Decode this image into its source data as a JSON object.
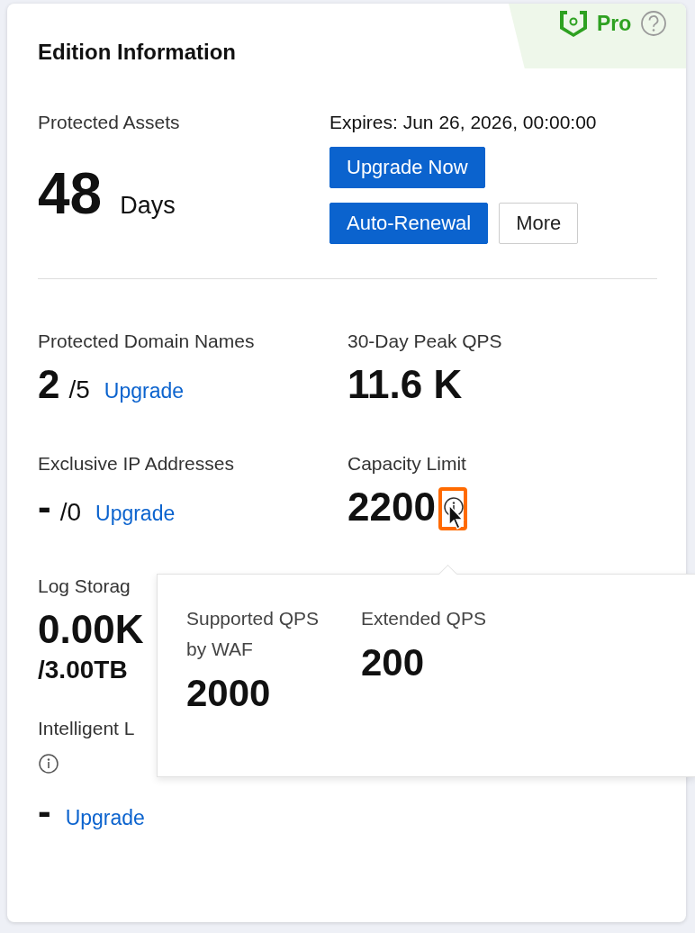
{
  "card": {
    "title": "Edition Information",
    "edition": "Pro"
  },
  "assets": {
    "label": "Protected Assets",
    "value": "48",
    "unit": "Days"
  },
  "expires": "Expires: Jun 26, 2026, 00:00:00",
  "buttons": [
    {
      "label": "Upgrade Now",
      "kind": "primary"
    },
    {
      "label": "Auto-Renewal",
      "kind": "primary"
    },
    {
      "label": "More",
      "kind": "secondary"
    }
  ],
  "left_metrics": [
    {
      "kind": "quota_inline",
      "label": "Protected Domain Names",
      "value": "2",
      "quota": "/5",
      "link": "Upgrade"
    },
    {
      "kind": "quota_inline",
      "label": "Exclusive IP Addresses",
      "value": "-",
      "quota": "/0",
      "link": "Upgrade"
    },
    {
      "kind": "quota_below",
      "label": "Log Storag",
      "value": "0.00K",
      "quota": "/3.00TB"
    },
    {
      "kind": "info_label",
      "label": "Intelligent L",
      "value": "-",
      "link": "Upgrade"
    }
  ],
  "right_metrics": [
    {
      "kind": "plain",
      "label": "30-Day Peak QPS",
      "value": "11.6 K"
    },
    {
      "kind": "info_value",
      "label": "Capacity Limit",
      "value": "2200"
    }
  ],
  "tooltip": {
    "items": [
      {
        "label": "Supported QPS by WAF",
        "value": "2000"
      },
      {
        "label": "Extended QPS",
        "value": "200"
      }
    ]
  }
}
